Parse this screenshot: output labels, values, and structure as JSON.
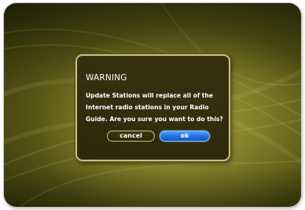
{
  "dialog": {
    "title": "WARNING",
    "message_lines": [
      "Update Stations will replace all of the",
      "Internet radio stations in your Radio",
      "Guide. Are you sure you want to do this?"
    ],
    "cancel_label": "cancel",
    "ok_label": "ok",
    "focused_button": "ok"
  },
  "colors": {
    "background_olive": "#6c6c1c",
    "dialog_border": "#c8bf86",
    "ok_button_blue": "#1f6fe0",
    "text": "#ffffff"
  }
}
